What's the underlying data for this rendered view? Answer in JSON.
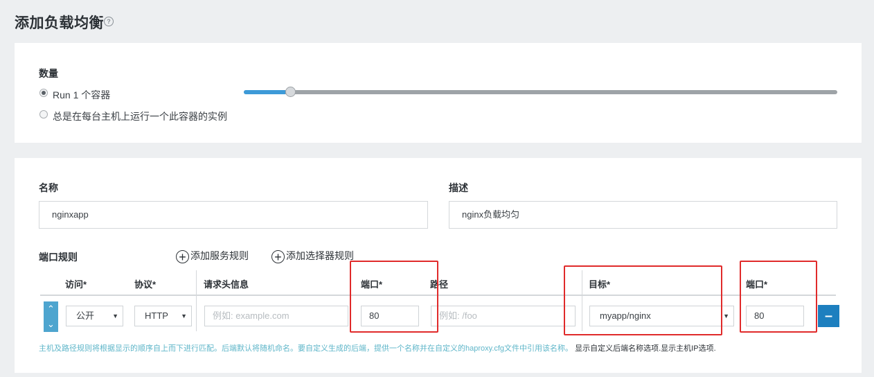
{
  "page": {
    "title": "添加负载均衡",
    "help_icon": "?"
  },
  "scale": {
    "label": "数量",
    "options": [
      {
        "label": "Run 1 个容器",
        "checked": true
      },
      {
        "label": "总是在每台主机上运行一个此容器的实例",
        "checked": false
      }
    ],
    "slider_fraction": 0.07
  },
  "form": {
    "name_label": "名称",
    "name_value": "nginxapp",
    "description_label": "描述",
    "description_value": "nginx负载均匀"
  },
  "port_rules": {
    "label": "端口规则",
    "add_service_rule": "添加服务规则",
    "add_selector_rule": "添加选择器规则",
    "columns": {
      "access": "访问*",
      "protocol": "协议*",
      "request_host": "请求头信息",
      "port": "端口*",
      "path": "路径",
      "target": "目标*",
      "target_port": "端口*"
    },
    "row": {
      "access": "公开",
      "protocol": "HTTP",
      "request_host_placeholder": "例如: example.com",
      "port": "80",
      "path_placeholder": "例如: /foo",
      "target": "myapp/nginx",
      "target_port": "80"
    },
    "help_text": "主机及路径规则将根据显示的顺序自上而下进行匹配。后端默认将随机命名。要自定义生成的后端，提供一个名称并在自定义的haproxy.cfg文件中引用该名称。",
    "link_backend_name": "显示自定义后端名称选项.",
    "link_host_ip": "显示主机IP选项."
  },
  "colors": {
    "accent": "#3d9ad8",
    "remove_button": "#1d7fbf",
    "highlight_box": "#e02a2a",
    "help_text": "#5fb6c9"
  },
  "icons": [
    "help-icon",
    "plus-circle-icon",
    "chevron-up-icon",
    "chevron-down-icon",
    "minus-icon",
    "caret-down-icon"
  ]
}
